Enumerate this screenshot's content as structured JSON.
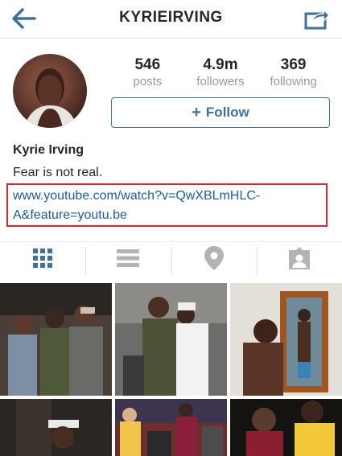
{
  "header": {
    "title": "KYRIEIRVING",
    "back_icon": "back-arrow-icon",
    "share_icon": "share-icon"
  },
  "profile": {
    "stats": [
      {
        "value": "546",
        "label": "posts"
      },
      {
        "value": "4.9m",
        "label": "followers"
      },
      {
        "value": "369",
        "label": "following"
      }
    ],
    "follow_label": "Follow",
    "name": "Kyrie Irving",
    "bio": "Fear is not real.",
    "link": "www.youtube.com/watch?v=QwXBLmHLC-A&feature=youtu.be"
  },
  "tabs": [
    {
      "icon": "grid-icon",
      "active": true
    },
    {
      "icon": "list-icon",
      "active": false
    },
    {
      "icon": "location-pin-icon",
      "active": false
    },
    {
      "icon": "tagged-photos-icon",
      "active": false
    }
  ],
  "colors": {
    "accent": "#3f729b",
    "active_tab": "#3f729b",
    "inactive_tab": "#b3b3b3",
    "link": "#1d5ca0",
    "highlight_border": "#d9262c"
  }
}
